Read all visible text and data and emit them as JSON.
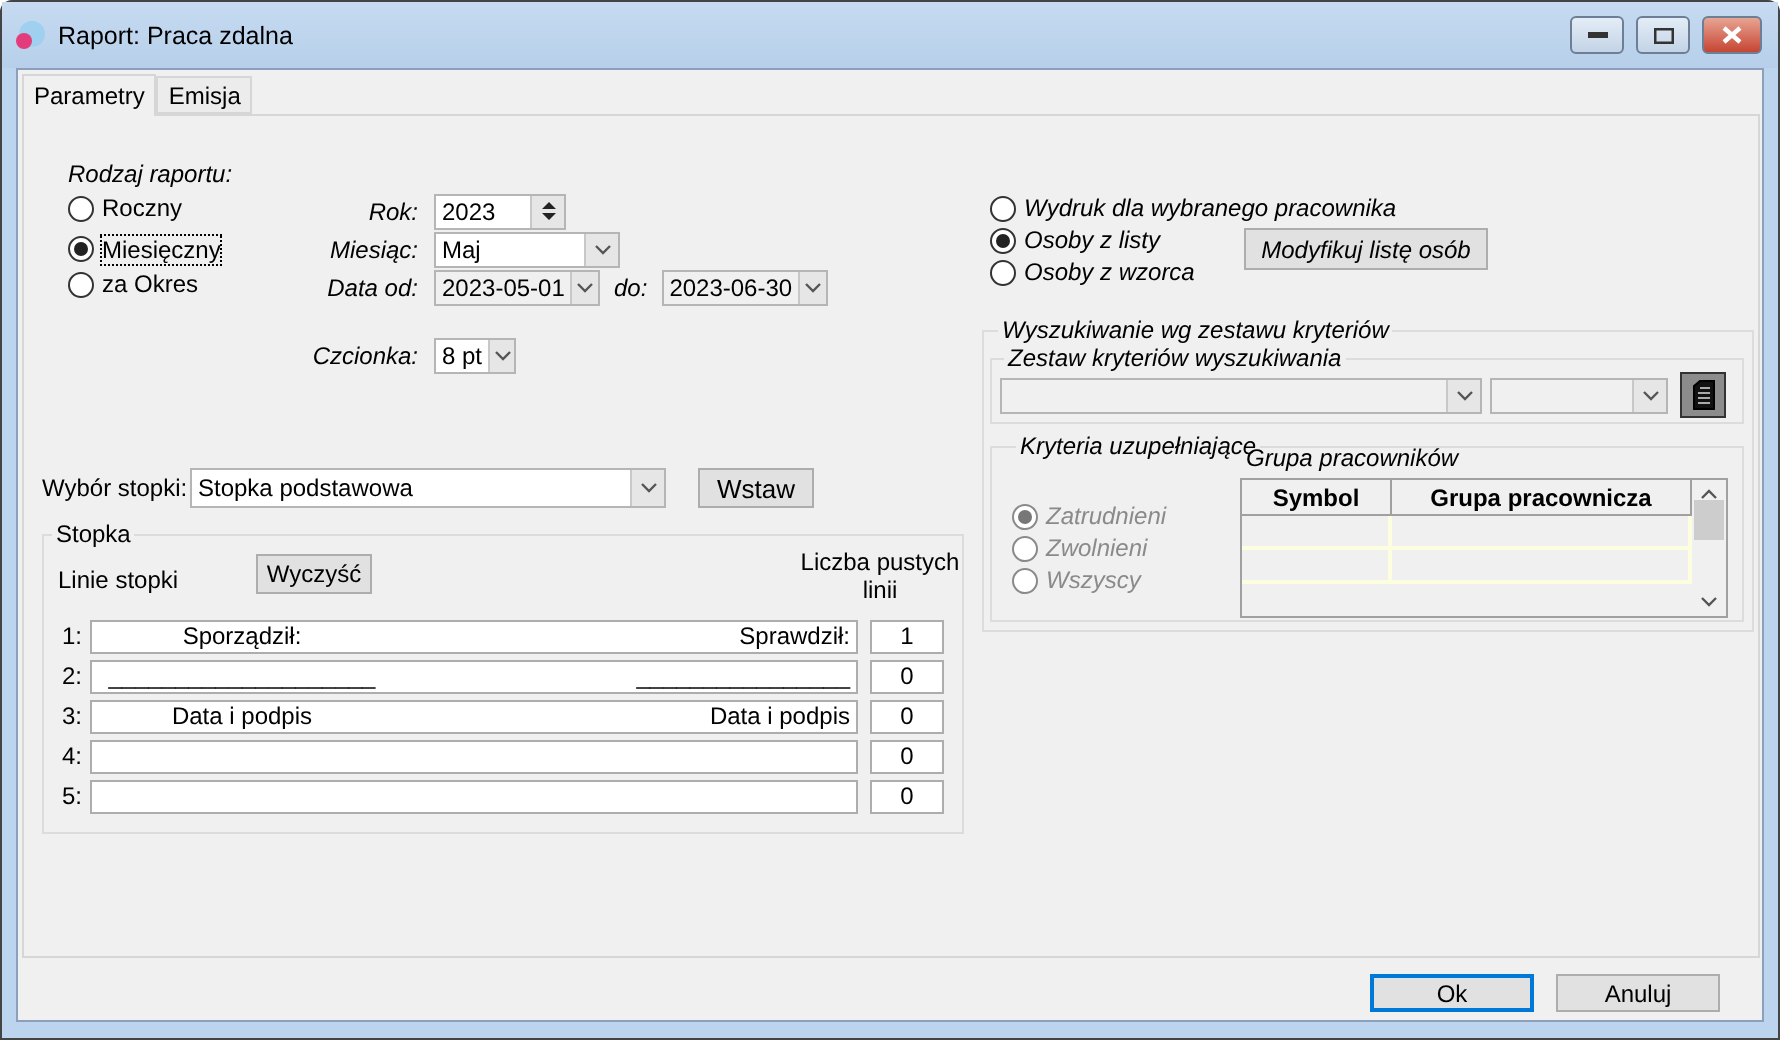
{
  "window": {
    "title": "Raport: Praca zdalna"
  },
  "tabs": [
    {
      "label": "Parametry",
      "selected": true
    },
    {
      "label": "Emisja",
      "selected": false
    }
  ],
  "report_type": {
    "label": "Rodzaj raportu:",
    "options": [
      {
        "label": "Roczny",
        "selected": false,
        "focused": false
      },
      {
        "label": "Miesięczny",
        "selected": true,
        "focused": true
      },
      {
        "label": "za Okres",
        "selected": false,
        "focused": false
      }
    ]
  },
  "period": {
    "year": {
      "label": "Rok:",
      "value": "2023"
    },
    "month": {
      "label": "Miesiąc:",
      "value": "Maj"
    },
    "date_from": {
      "label": "Data od:",
      "value": "2023-05-01"
    },
    "date_to": {
      "label": "do:",
      "value": "2023-06-30"
    }
  },
  "font": {
    "label": "Czcionka:",
    "value": "8 pt"
  },
  "footer_select": {
    "label": "Wybór stopki:",
    "value": "Stopka podstawowa",
    "button": "Wstaw"
  },
  "footer": {
    "title": "Stopka",
    "lines_label": "Linie stopki",
    "clear_button": "Wyczyść",
    "blank_lines_label": "Liczba pustych linii",
    "lines": [
      {
        "number": "1:",
        "left": "Sporządził:",
        "right": "Sprawdził:",
        "blank_lines": "1"
      },
      {
        "number": "2:",
        "left": "____________________",
        "right": "________________",
        "blank_lines": "0"
      },
      {
        "number": "3:",
        "left": "Data i podpis",
        "right": "Data i podpis",
        "blank_lines": "0"
      },
      {
        "number": "4:",
        "blank_lines": "0"
      },
      {
        "number": "5:",
        "blank_lines": "0"
      }
    ]
  },
  "print_scope": {
    "options": [
      {
        "label": "Wydruk dla wybranego pracownika",
        "selected": false
      },
      {
        "label": "Osoby z listy",
        "selected": true
      },
      {
        "label": "Osoby z wzorca",
        "selected": false
      }
    ],
    "button": "Modyfikuj listę osób"
  },
  "criteria_search": {
    "title": "Wyszukiwanie wg zestawu kryteriów",
    "set_title": "Zestaw kryteriów wyszukiwania",
    "supplementary": {
      "title": "Kryteria uzupełniające",
      "disabled": true,
      "options": [
        {
          "label": "Zatrudnieni",
          "selected": true
        },
        {
          "label": "Zwolnieni",
          "selected": false
        },
        {
          "label": "Wszyscy",
          "selected": false
        }
      ],
      "group": {
        "title": "Grupa pracowników",
        "columns": [
          "Symbol",
          "Grupa pracownicza"
        ]
      }
    }
  },
  "buttons": [
    {
      "label": "Ok",
      "default": true
    },
    {
      "label": "Anuluj",
      "default": false
    }
  ]
}
